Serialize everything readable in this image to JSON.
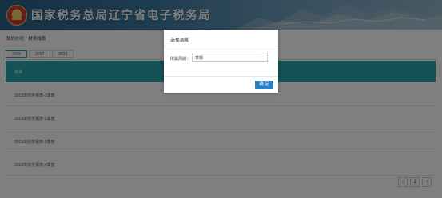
{
  "header": {
    "title": "国家税务总局辽宁省电子税务局"
  },
  "breadcrumb": {
    "home": "我的办税",
    "separator": "/",
    "current": "财务报表"
  },
  "tabs": [
    {
      "label": "2018"
    },
    {
      "label": "2017"
    },
    {
      "label": "2016"
    }
  ],
  "table": {
    "header": "名称",
    "rows": [
      {
        "label": "2018年财务报表-1季度"
      },
      {
        "label": "2018年财务报表-2季度"
      },
      {
        "label": "2018年财务报表-3季度"
      },
      {
        "label": "2018年财务报表-4季度"
      }
    ]
  },
  "pager": {
    "prev": "‹",
    "page": "1",
    "next": "›"
  },
  "modal": {
    "title": "选择周期",
    "field_label": "所属周期：",
    "select_value": "季报",
    "confirm_label": "确 定"
  },
  "colors": {
    "header": "#3e7aa0",
    "accent": "#29a5aa",
    "primary_button": "#2c7fbf"
  }
}
